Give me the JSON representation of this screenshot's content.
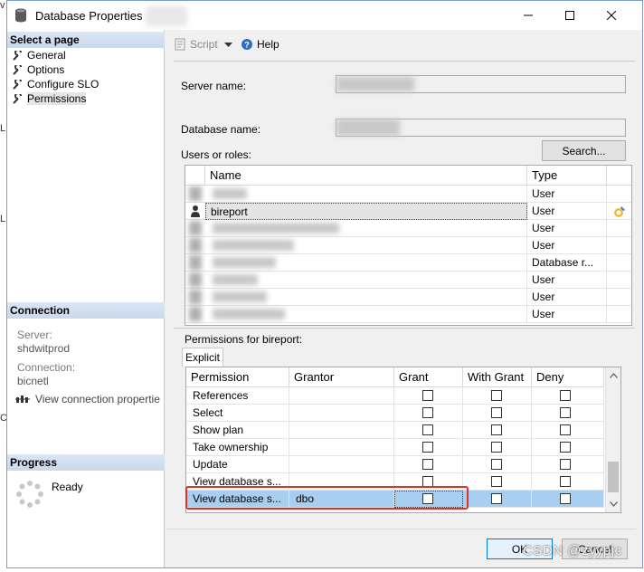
{
  "window": {
    "title": "Database Properties"
  },
  "left_pane": {
    "select_page_header": "Select a page",
    "pages": [
      {
        "label": "General"
      },
      {
        "label": "Options"
      },
      {
        "label": "Configure SLO"
      },
      {
        "label": "Permissions"
      }
    ],
    "connection_header": "Connection",
    "server_label": "Server:",
    "server_value": "shdwitprod",
    "connection_label": "Connection:",
    "connection_value": "bicnetl",
    "view_connection_link": "View connection propertie",
    "progress_header": "Progress",
    "progress_status": "Ready"
  },
  "toolbar": {
    "script_label": "Script",
    "help_label": "Help"
  },
  "form": {
    "server_name_label": "Server name:",
    "database_name_label": "Database name:",
    "users_roles_label": "Users or roles:",
    "search_button": "Search..."
  },
  "users_grid": {
    "headers": {
      "name": "Name",
      "type": "Type"
    },
    "rows": [
      {
        "name": "",
        "type": "User"
      },
      {
        "name": "bireport",
        "type": "User"
      },
      {
        "name": "",
        "type": "User"
      },
      {
        "name": "",
        "type": "User"
      },
      {
        "name": "",
        "type": "Database r..."
      },
      {
        "name": "",
        "type": "User"
      },
      {
        "name": "",
        "type": "User"
      },
      {
        "name": "",
        "type": "User"
      }
    ]
  },
  "permissions": {
    "label": "Permissions for bireport:",
    "tab_explicit": "Explicit",
    "headers": {
      "permission": "Permission",
      "grantor": "Grantor",
      "grant": "Grant",
      "with_grant": "With Grant",
      "deny": "Deny"
    },
    "rows": [
      {
        "permission": "References",
        "grantor": ""
      },
      {
        "permission": "Select",
        "grantor": ""
      },
      {
        "permission": "Show plan",
        "grantor": ""
      },
      {
        "permission": "Take ownership",
        "grantor": ""
      },
      {
        "permission": "Update",
        "grantor": ""
      },
      {
        "permission": "View database s...",
        "grantor": ""
      },
      {
        "permission": "View database s...",
        "grantor": "dbo"
      }
    ]
  },
  "buttons": {
    "ok": "OK",
    "cancel": "Cancel"
  },
  "watermark": "CSDN @zyypjc",
  "colors": {
    "selection": "#a8cff0",
    "highlight_border": "#e0302a",
    "header_gradient": "#c9d8ec"
  }
}
